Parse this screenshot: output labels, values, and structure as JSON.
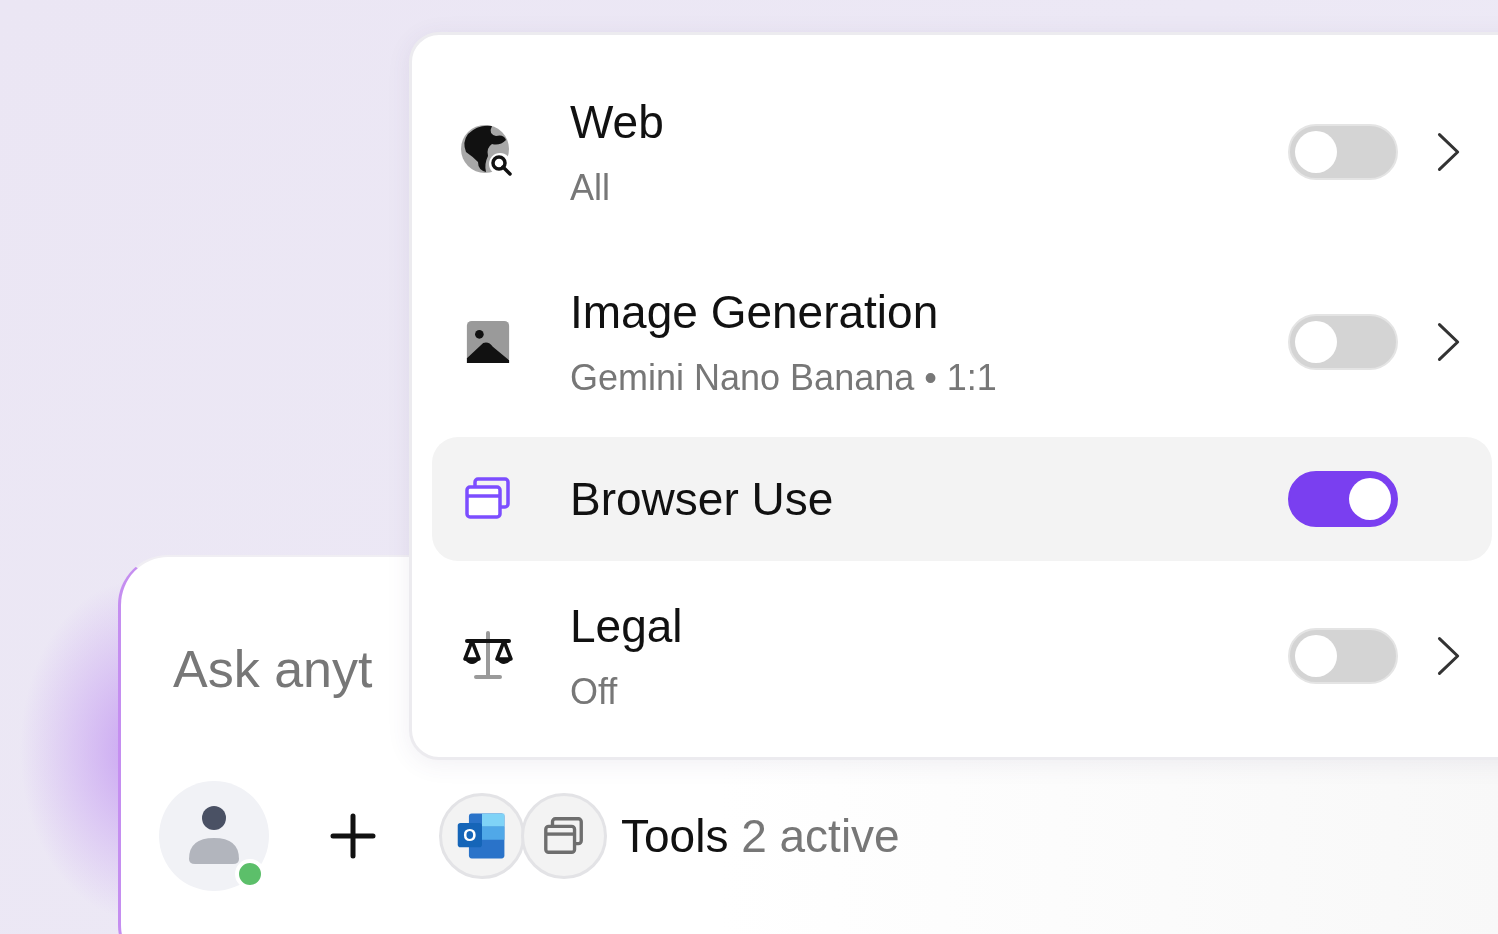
{
  "composer": {
    "placeholder": "Ask anyt",
    "tools_label": "Tools",
    "tools_count": "2 active",
    "tool_badges": [
      {
        "kind": "outlook",
        "letter": "O"
      },
      {
        "kind": "browser"
      }
    ]
  },
  "menu": {
    "items": [
      {
        "title": "Web",
        "subtitle": "All",
        "on": false,
        "selected": false,
        "submenu": true
      },
      {
        "title": "Image Generation",
        "subtitle": "Gemini Nano Banana • 1:1",
        "on": false,
        "selected": false,
        "submenu": true
      },
      {
        "title": "Browser Use",
        "on": true,
        "selected": true,
        "submenu": false
      },
      {
        "title": "Legal",
        "subtitle": "Off",
        "on": false,
        "selected": false,
        "submenu": true
      }
    ]
  }
}
